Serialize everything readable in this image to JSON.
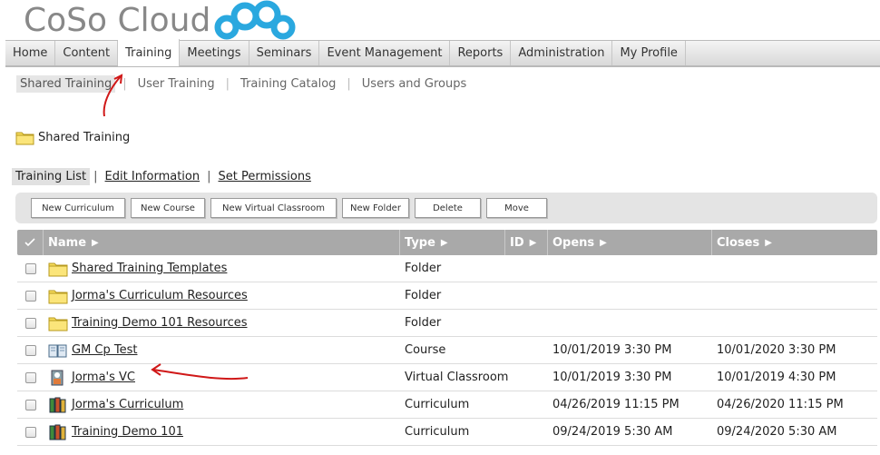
{
  "brand": {
    "name": "CoSo Cloud"
  },
  "main_nav": [
    {
      "label": "Home",
      "active": false
    },
    {
      "label": "Content",
      "active": false
    },
    {
      "label": "Training",
      "active": true
    },
    {
      "label": "Meetings",
      "active": false
    },
    {
      "label": "Seminars",
      "active": false
    },
    {
      "label": "Event Management",
      "active": false
    },
    {
      "label": "Reports",
      "active": false
    },
    {
      "label": "Administration",
      "active": false
    },
    {
      "label": "My Profile",
      "active": false
    }
  ],
  "sub_nav": [
    {
      "label": "Shared Training",
      "active": true
    },
    {
      "label": "User Training",
      "active": false
    },
    {
      "label": "Training Catalog",
      "active": false
    },
    {
      "label": "Users and Groups",
      "active": false
    }
  ],
  "folder_heading": {
    "label": "Shared Training",
    "icon": "folder-icon"
  },
  "tabs": [
    {
      "label": "Training List",
      "active": true
    },
    {
      "label": "Edit Information",
      "active": false
    },
    {
      "label": "Set Permissions",
      "active": false
    }
  ],
  "toolbar": {
    "buttons": [
      "New Curriculum",
      "New Course",
      "New Virtual Classroom",
      "New Folder",
      "Delete",
      "Move"
    ]
  },
  "table": {
    "columns": [
      "Name",
      "Type",
      "ID",
      "Opens",
      "Closes"
    ],
    "rows": [
      {
        "icon": "folder-icon",
        "name": "Shared Training Templates",
        "type": "Folder",
        "id": "",
        "opens": "",
        "closes": ""
      },
      {
        "icon": "folder-icon",
        "name": "Jorma's Curriculum Resources",
        "type": "Folder",
        "id": "",
        "opens": "",
        "closes": ""
      },
      {
        "icon": "folder-icon",
        "name": "Training Demo 101 Resources",
        "type": "Folder",
        "id": "",
        "opens": "",
        "closes": ""
      },
      {
        "icon": "book-icon",
        "name": "GM Cp Test",
        "type": "Course",
        "id": "",
        "opens": "10/01/2019 3:30 PM",
        "closes": "10/01/2020 3:30 PM"
      },
      {
        "icon": "classroom-icon",
        "name": "Jorma's VC",
        "type": "Virtual Classroom",
        "id": "",
        "opens": "10/01/2019 3:30 PM",
        "closes": "10/01/2019 4:30 PM"
      },
      {
        "icon": "curriculum-icon",
        "name": "Jorma's Curriculum",
        "type": "Curriculum",
        "id": "",
        "opens": "04/26/2019 11:15 PM",
        "closes": "04/26/2020 11:15 PM"
      },
      {
        "icon": "curriculum-icon",
        "name": "Training Demo 101",
        "type": "Curriculum",
        "id": "",
        "opens": "09/24/2019 5:30 AM",
        "closes": "09/24/2020 5:30 AM"
      }
    ]
  },
  "colors": {
    "header_gray": "#a9a9a9",
    "annotation_red": "#d01818",
    "logo_blue": "#2aa8df",
    "logo_gray": "#888888"
  }
}
